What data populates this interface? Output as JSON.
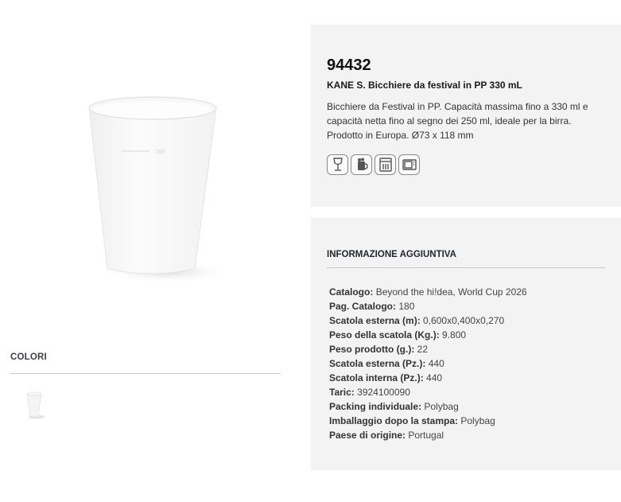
{
  "product": {
    "code": "94432",
    "name": "KANE S. Bicchiere da festival in PP 330 mL",
    "description": "Bicchiere da Festival in PP. Capacità massima fino a 330 ml e capacità netta fino al segno dei 250 ml, ideale per la birra. Prodotto in Europa. Ø73 x 118 mm",
    "feature_icons": [
      "glass-icon",
      "beer-icon",
      "dishwasher-icon",
      "microwave-icon"
    ]
  },
  "colors": {
    "title": "COLORI",
    "swatches": [
      "transparent-white"
    ]
  },
  "info": {
    "title": "INFORMAZIONE AGGIUNTIVA",
    "rows": [
      {
        "label": "Catalogo:",
        "value": "Beyond the hi!dea, World Cup 2026"
      },
      {
        "label": "Pag. Catalogo:",
        "value": "180"
      },
      {
        "label": "Scatola esterna (m):",
        "value": "0,600x0,400x0,270"
      },
      {
        "label": "Peso della scatola (Kg.):",
        "value": "9.800"
      },
      {
        "label": "Peso prodotto (g.):",
        "value": "22"
      },
      {
        "label": "Scatola esterna (Pz.):",
        "value": "440"
      },
      {
        "label": "Scatola interna (Pz.):",
        "value": "440"
      },
      {
        "label": "Taric:",
        "value": "3924100090"
      },
      {
        "label": "Packing individuale:",
        "value": "Polybag"
      },
      {
        "label": "Imballaggio dopo la stampa:",
        "value": "Polybag"
      },
      {
        "label": "Paese di origine:",
        "value": "Portugal"
      }
    ]
  }
}
